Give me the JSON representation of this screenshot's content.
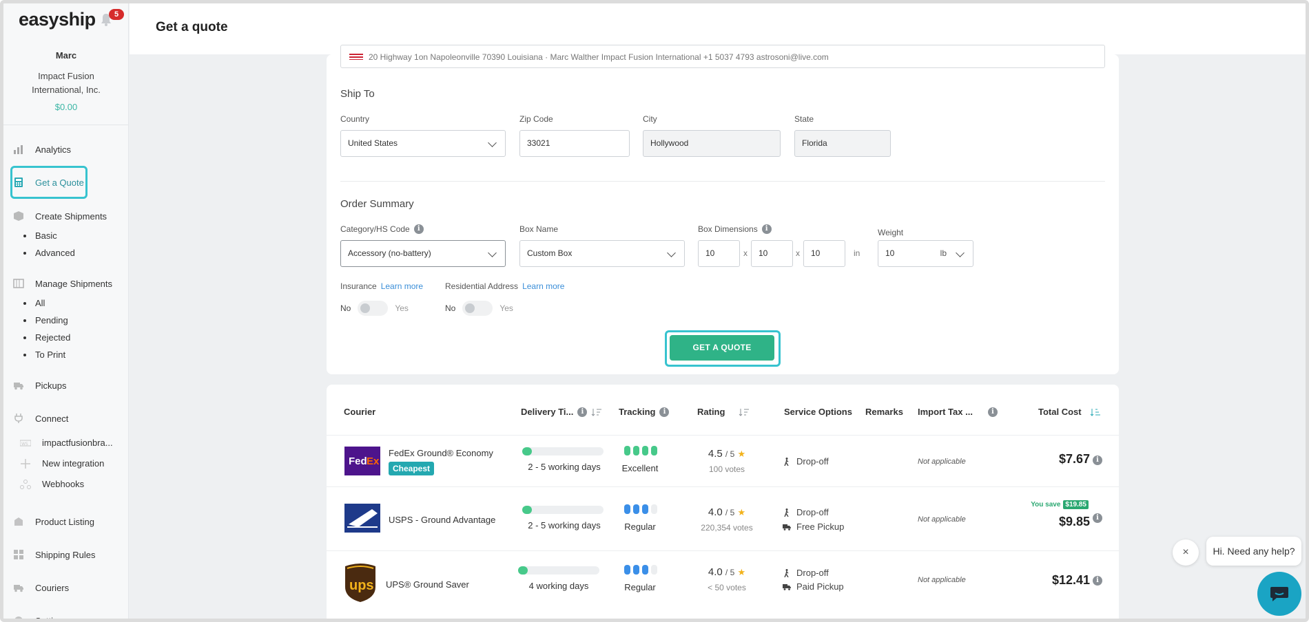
{
  "app": {
    "logo_text": "easyship",
    "notification_count": "5"
  },
  "user": {
    "name": "Marc",
    "company": "Impact Fusion International, Inc.",
    "balance": "$0.00"
  },
  "sidebar": {
    "analytics": "Analytics",
    "get_quote": "Get a Quote",
    "create_shipments": "Create Shipments",
    "create_sub": [
      "Basic",
      "Advanced"
    ],
    "manage_shipments": "Manage Shipments",
    "manage_sub": [
      "All",
      "Pending",
      "Rejected",
      "To Print"
    ],
    "pickups": "Pickups",
    "connect": "Connect",
    "connect_sub": [
      "impactfusionbra...",
      "New integration",
      "Webhooks"
    ],
    "product_listing": "Product Listing",
    "shipping_rules": "Shipping Rules",
    "couriers": "Couriers",
    "settings": "Settings"
  },
  "header": {
    "title": "Get a quote"
  },
  "ship_from": {
    "address": "20 Highway 1on Napoleonville 70390 Louisiana · Marc Walther Impact Fusion International +1 5037 4793 astrosoni@live.com"
  },
  "ship_to": {
    "title": "Ship To",
    "country_label": "Country",
    "country_value": "United States",
    "zip_label": "Zip Code",
    "zip_value": "33021",
    "city_label": "City",
    "city_value": "Hollywood",
    "state_label": "State",
    "state_value": "Florida"
  },
  "order": {
    "title": "Order Summary",
    "category_label": "Category/HS Code",
    "category_value": "Accessory (no-battery)",
    "box_label": "Box Name",
    "box_value": "Custom Box",
    "dims_label": "Box Dimensions",
    "dim_l": "10",
    "dim_w": "10",
    "dim_h": "10",
    "dim_unit": "in",
    "dim_sep": "x",
    "weight_label": "Weight",
    "weight_value": "10",
    "weight_unit": "lb",
    "insurance_label": "Insurance",
    "residential_label": "Residential Address",
    "learn_more": "Learn more",
    "no": "No",
    "yes": "Yes",
    "button": "GET A QUOTE"
  },
  "results": {
    "headers": {
      "courier": "Courier",
      "delivery": "Delivery Ti...",
      "tracking": "Tracking",
      "rating": "Rating",
      "service": "Service Options",
      "remarks": "Remarks",
      "import_tax": "Import Tax ...",
      "total": "Total Cost"
    },
    "rows": [
      {
        "courier": "FedEx Ground® Economy",
        "badge": "Cheapest",
        "delivery": "2 - 5 working days",
        "delivery_fill": 0.12,
        "tracking_level": 4,
        "tracking_label": "Excellent",
        "rating": "4.5",
        "rating_of": "/ 5",
        "votes": "100 votes",
        "services": [
          "Drop-off"
        ],
        "import_tax": "Not applicable",
        "price": "$7.67"
      },
      {
        "courier": "USPS - Ground Advantage",
        "delivery": "2 - 5 working days",
        "delivery_fill": 0.12,
        "tracking_level": 3,
        "tracking_label": "Regular",
        "rating": "4.0",
        "rating_of": "/ 5",
        "votes": "220,354 votes",
        "services": [
          "Drop-off",
          "Free Pickup"
        ],
        "import_tax": "Not applicable",
        "price": "$9.85",
        "save_label": "You save",
        "save_amount": "$19.85"
      },
      {
        "courier": "UPS® Ground Saver",
        "delivery": "4 working days",
        "delivery_fill": 0.12,
        "tracking_level": 3,
        "tracking_label": "Regular",
        "rating": "4.0",
        "rating_of": "/ 5",
        "votes": "< 50 votes",
        "services": [
          "Drop-off",
          "Paid Pickup"
        ],
        "import_tax": "Not applicable",
        "price": "$12.41"
      }
    ]
  },
  "chat": {
    "bubble": "Hi. Need any help?",
    "close": "×"
  },
  "colors": {
    "accent": "#37c3cf",
    "primary_button": "#2fb387",
    "teal_text": "#3bb6a5",
    "badge_red": "#d62b2b"
  },
  "icons": [
    "bell-icon",
    "analytics-icon",
    "calculator-icon",
    "box-icon",
    "list-icon",
    "truck-icon",
    "plug-icon",
    "info-icon",
    "sort-icon",
    "star-icon",
    "walk-icon",
    "chat-icon",
    "close-icon",
    "chevron-down-icon"
  ]
}
